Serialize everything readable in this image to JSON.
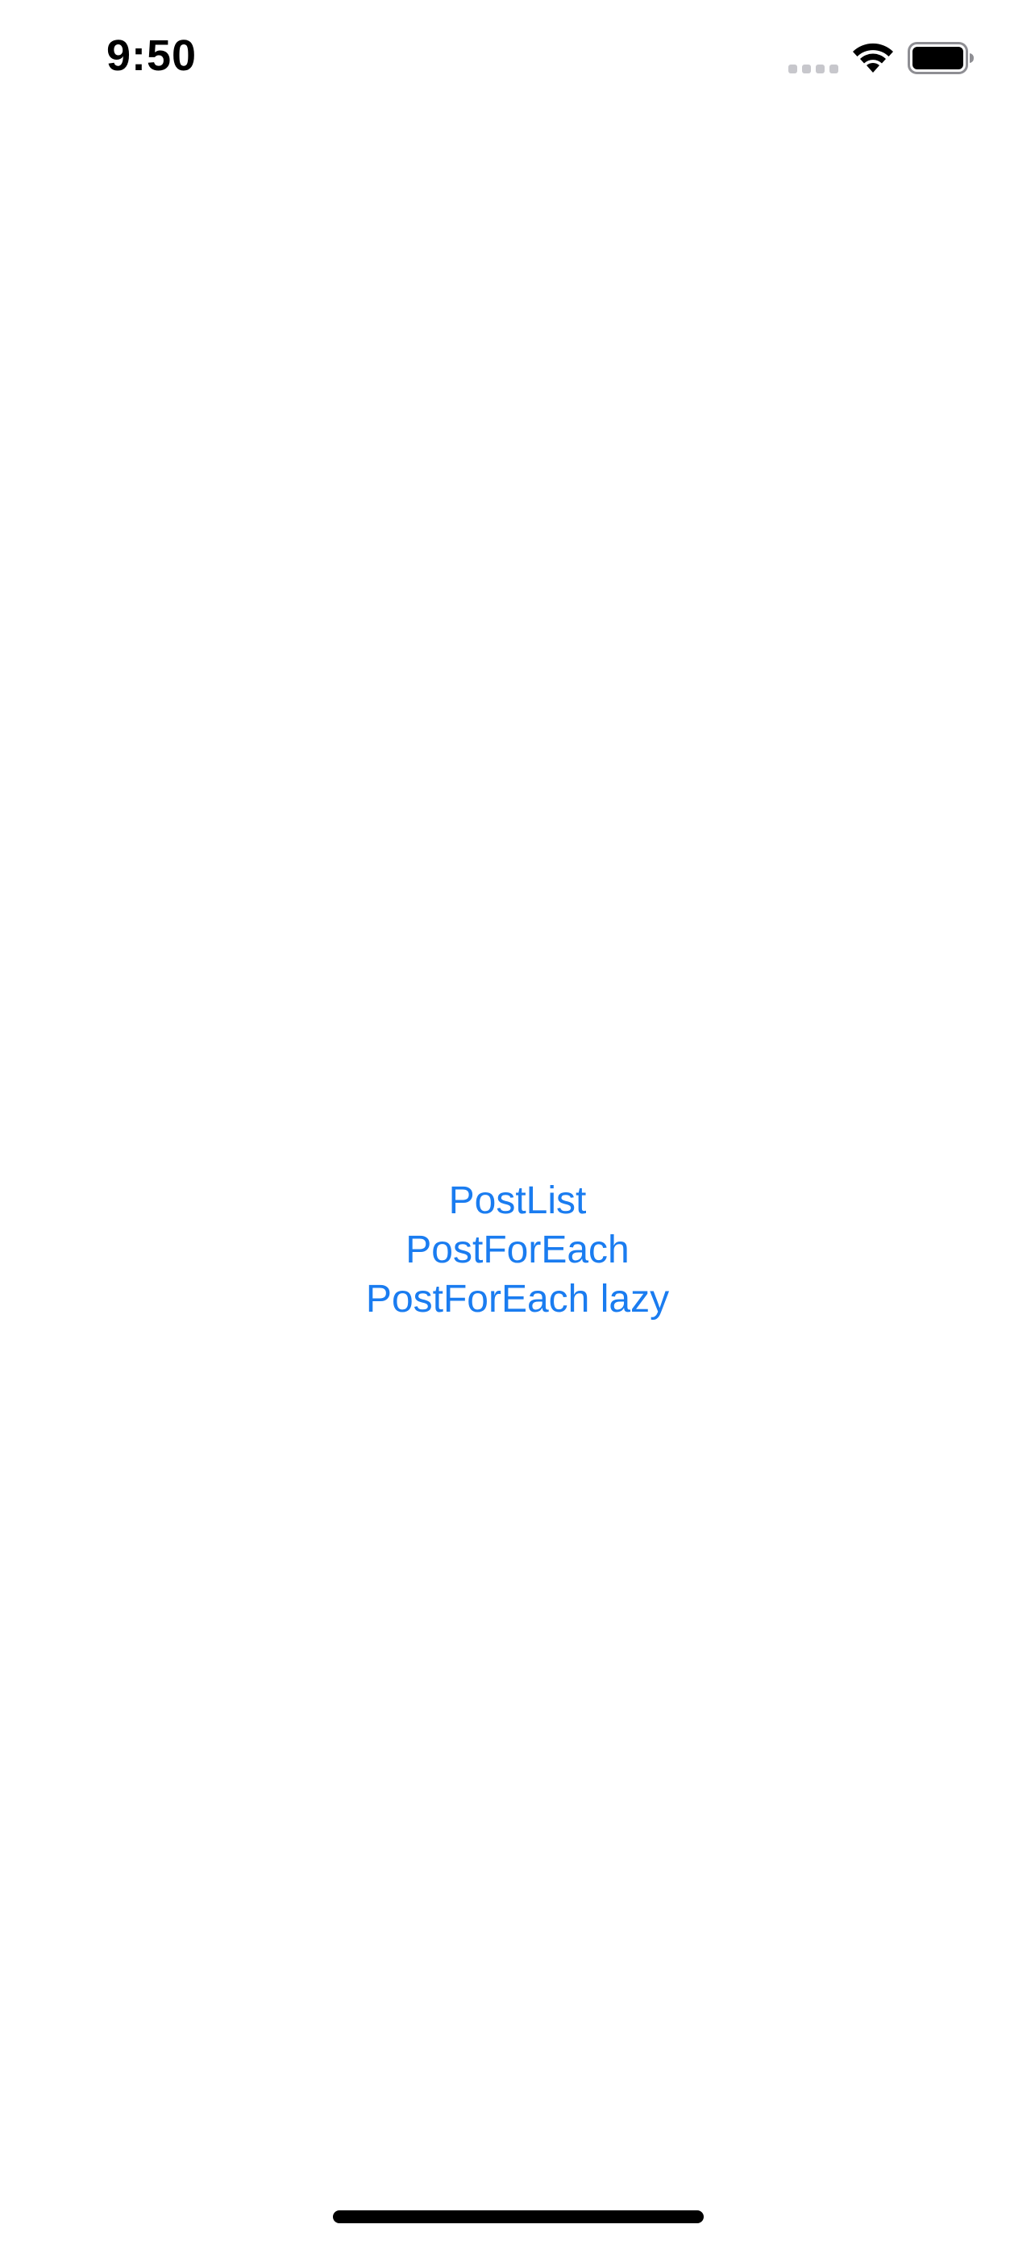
{
  "status_bar": {
    "time": "9:50",
    "signal_icon": "cellular-signal-icon",
    "wifi_icon": "wifi-icon",
    "battery_icon": "battery-icon"
  },
  "links": [
    {
      "label": "PostList"
    },
    {
      "label": "PostForEach"
    },
    {
      "label": "PostForEach lazy"
    }
  ],
  "colors": {
    "link": "#1a7cf0",
    "text": "#000000",
    "background": "#ffffff",
    "signal_inactive": "#c7c7cc"
  }
}
